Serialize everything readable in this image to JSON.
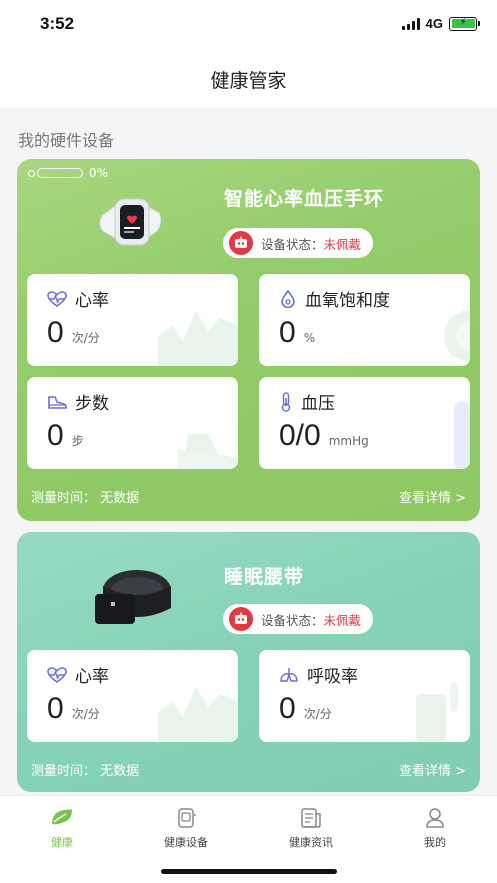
{
  "status_bar": {
    "time": "3:52",
    "network": "4G"
  },
  "nav": {
    "title": "健康管家"
  },
  "section_title": "我的硬件设备",
  "devices": [
    {
      "battery_percent": "0%",
      "name": "智能心率血压手环",
      "status_label": "设备状态：",
      "status_value": "未佩戴",
      "metrics": [
        {
          "label": "心率",
          "value": "0",
          "unit": "次/分"
        },
        {
          "label": "血氧饱和度",
          "value": "0",
          "unit": "%"
        },
        {
          "label": "步数",
          "value": "0",
          "unit": "步"
        },
        {
          "label": "血压",
          "value": "0/0",
          "unit": "mmHg"
        }
      ],
      "measure_label": "测量时间：",
      "measure_value": "无数据",
      "details_link": "查看详情 >"
    },
    {
      "name": "睡眠腰带",
      "status_label": "设备状态：",
      "status_value": "未佩戴",
      "metrics": [
        {
          "label": "心率",
          "value": "0",
          "unit": "次/分"
        },
        {
          "label": "呼吸率",
          "value": "0",
          "unit": "次/分"
        }
      ],
      "measure_label": "测量时间：",
      "measure_value": "无数据",
      "details_link": "查看详情 >"
    }
  ],
  "tabs": [
    {
      "label": "健康",
      "icon": "leaf-icon",
      "active": true
    },
    {
      "label": "健康设备",
      "icon": "device-icon",
      "active": false
    },
    {
      "label": "健康资讯",
      "icon": "news-icon",
      "active": false
    },
    {
      "label": "我的",
      "icon": "profile-icon",
      "active": false
    }
  ],
  "colors": {
    "accent": "#7cc34e",
    "alert": "#e23a45",
    "card_green": "#93cc6a",
    "card_teal": "#86d2b6"
  }
}
